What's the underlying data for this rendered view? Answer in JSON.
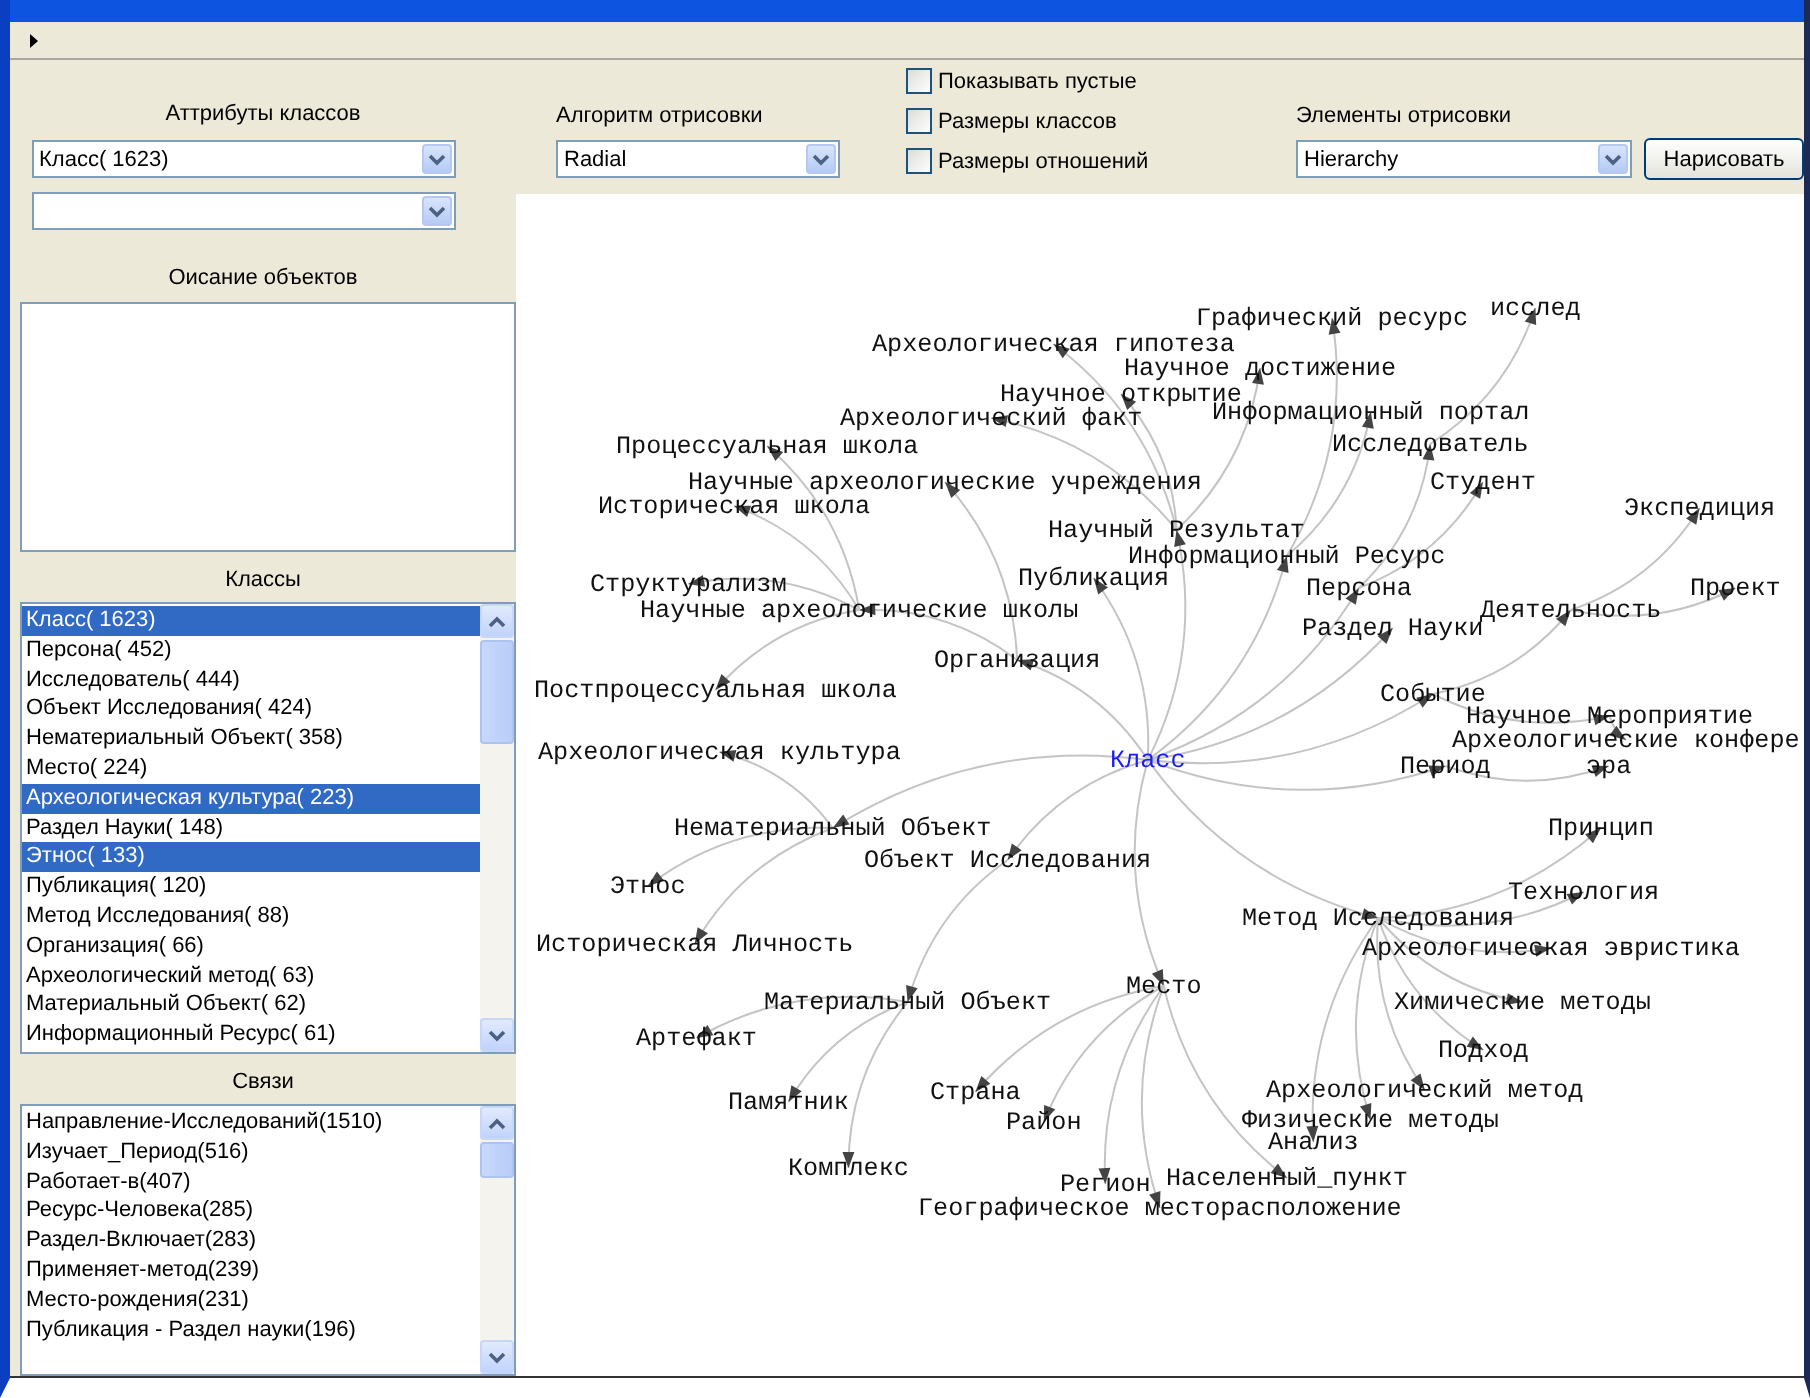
{
  "left_panel": {
    "attributes_label": "Аттрибуты классов",
    "attribute_select": {
      "value": "Класс( 1623)"
    },
    "description_label": "Оисание объектов",
    "classes_label": "Классы",
    "classes": [
      {
        "label": "Класс( 1623)",
        "selected": true
      },
      {
        "label": "Персона( 452)",
        "selected": false
      },
      {
        "label": "Исследователь( 444)",
        "selected": false
      },
      {
        "label": "Объект Исследования( 424)",
        "selected": false
      },
      {
        "label": "Нематериальный Объект( 358)",
        "selected": false
      },
      {
        "label": "Место( 224)",
        "selected": false
      },
      {
        "label": "Археологическая культура( 223)",
        "selected": true
      },
      {
        "label": "Раздел Науки( 148)",
        "selected": false
      },
      {
        "label": "Этнос( 133)",
        "selected": true
      },
      {
        "label": "Публикация( 120)",
        "selected": false
      },
      {
        "label": "Метод Исследования( 88)",
        "selected": false
      },
      {
        "label": "Организация( 66)",
        "selected": false
      },
      {
        "label": "Археологический метод( 63)",
        "selected": false
      },
      {
        "label": "Материальный Объект( 62)",
        "selected": false
      },
      {
        "label": "Информационный Ресурс( 61)",
        "selected": false
      }
    ],
    "relations_label": "Связи",
    "relations": [
      {
        "label": "Направление-Исследований(1510)",
        "selected": false
      },
      {
        "label": "Изучает_Период(516)",
        "selected": false
      },
      {
        "label": "Работает-в(407)",
        "selected": false
      },
      {
        "label": "Ресурс-Человека(285)",
        "selected": false
      },
      {
        "label": "Раздел-Включает(283)",
        "selected": false
      },
      {
        "label": "Применяет-метод(239)",
        "selected": false
      },
      {
        "label": "Место-рождения(231)",
        "selected": false
      },
      {
        "label": "Публикация - Раздел науки(196)",
        "selected": false
      }
    ]
  },
  "toolbar": {
    "algorithm_label": "Алгоритм отрисовки",
    "algorithm_select": {
      "value": "Radial"
    },
    "checkboxes": [
      {
        "label": "Показывать пустые",
        "checked": false
      },
      {
        "label": "Размеры классов",
        "checked": false
      },
      {
        "label": "Размеры отношений",
        "checked": false
      }
    ],
    "elements_label": "Элементы отрисовки",
    "elements_select": {
      "value": "Hierarchy"
    },
    "draw_button": "Нарисовать"
  },
  "graph": {
    "root": {
      "label": "Класс",
      "children": [
        {
          "label": "Научный Результат",
          "children": [
            {
              "label": "Археологическая гипотеза"
            },
            {
              "label": "Научное достижение"
            },
            {
              "label": "Научное открытие"
            },
            {
              "label": "Археологический факт"
            }
          ]
        },
        {
          "label": "Информационный Ресурс",
          "children": [
            {
              "label": "Графический ресурс"
            },
            {
              "label": "Информационный портал"
            }
          ]
        },
        {
          "label": "Публикация"
        },
        {
          "label": "Персона",
          "children": [
            {
              "label": "Исследователь",
              "children": [
                {
                  "label": "исслед"
                }
              ]
            },
            {
              "label": "Студент"
            }
          ]
        },
        {
          "label": "Раздел Науки"
        },
        {
          "label": "Организация",
          "children": [
            {
              "label": "Научные археологические учреждения"
            },
            {
              "label": "Научные археологические школы",
              "children": [
                {
                  "label": "Процессуальная школа"
                },
                {
                  "label": "Историческая школа"
                },
                {
                  "label": "Структурализм"
                },
                {
                  "label": "Постпроцессуальная школа"
                }
              ]
            }
          ]
        },
        {
          "label": "Событие",
          "children": [
            {
              "label": "Деятельность",
              "children": [
                {
                  "label": "Экспедиция"
                },
                {
                  "label": "Проект"
                }
              ]
            },
            {
              "label": "Научное Мероприятие",
              "children": [
                {
                  "label": "Археологические конфере"
                }
              ]
            }
          ]
        },
        {
          "label": "Период",
          "children": [
            {
              "label": "эра"
            }
          ]
        },
        {
          "label": "Нематериальный Объект",
          "children": [
            {
              "label": "Археологическая культура"
            },
            {
              "label": "Этнос"
            },
            {
              "label": "Историческая Личность"
            }
          ]
        },
        {
          "label": "Объект Исследования",
          "children": [
            {
              "label": "Материальный Объект",
              "children": [
                {
                  "label": "Артефакт"
                },
                {
                  "label": "Памятник"
                },
                {
                  "label": "Комплекс"
                }
              ]
            }
          ]
        },
        {
          "label": "Метод Исследования",
          "children": [
            {
              "label": "Принцип"
            },
            {
              "label": "Технология"
            },
            {
              "label": "Археологическая эвристика"
            },
            {
              "label": "Химические методы"
            },
            {
              "label": "Подход"
            },
            {
              "label": "Археологический метод"
            },
            {
              "label": "Физические методы"
            },
            {
              "label": "Анализ"
            }
          ]
        },
        {
          "label": "Место",
          "children": [
            {
              "label": "Страна"
            },
            {
              "label": "Район"
            },
            {
              "label": "Регион"
            },
            {
              "label": "Населенный_пункт"
            },
            {
              "label": "Географическое месторасположение"
            }
          ]
        }
      ]
    }
  }
}
